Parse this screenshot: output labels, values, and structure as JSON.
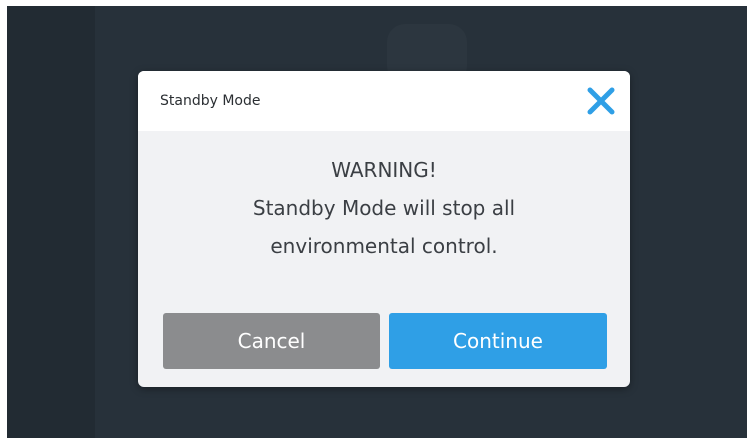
{
  "dialog": {
    "title": "Standby Mode",
    "warning_heading": "WARNING!",
    "message_line_1": "Standby Mode will stop all",
    "message_line_2": "environmental control.",
    "close_icon": "close-x",
    "cancel_label": "Cancel",
    "continue_label": "Continue"
  },
  "colors": {
    "backdrop": "#27313a",
    "dialog_body": "#f1f2f4",
    "dialog_header": "#ffffff",
    "close_icon": "#2f9fe6",
    "cancel_button": "#8b8c8e",
    "continue_button": "#2f9fe6"
  }
}
